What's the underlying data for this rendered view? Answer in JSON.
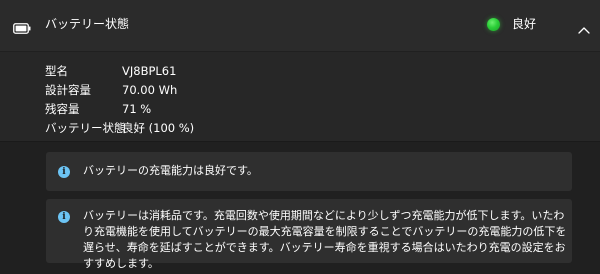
{
  "header": {
    "title": "バッテリー状態",
    "status_text": "良好",
    "status_color": "#2bcf38",
    "icons": {
      "battery": "battery-icon",
      "collapse": "chevron-up-icon"
    }
  },
  "details": {
    "rows": [
      {
        "label": "型名",
        "value": "VJ8BPL61"
      },
      {
        "label": "設計容量",
        "value": "70.00 Wh"
      },
      {
        "label": "残容量",
        "value": "71 %"
      },
      {
        "label": "バッテリー状態",
        "value": "良好 (100 %)"
      }
    ]
  },
  "notices": [
    {
      "icon": "info-icon",
      "text": "バッテリーの充電能力は良好です。"
    },
    {
      "icon": "info-icon",
      "text": "バッテリーは消耗品です。充電回数や使用期間などにより少しずつ充電能力が低下します。いたわり充電機能を使用してバッテリーの最大充電容量を制限することでバッテリーの充電能力の低下を遅らせ、寿命を延ばすことができます。バッテリー寿命を重視する場合はいたわり充電の設定をおすすめします。"
    }
  ]
}
